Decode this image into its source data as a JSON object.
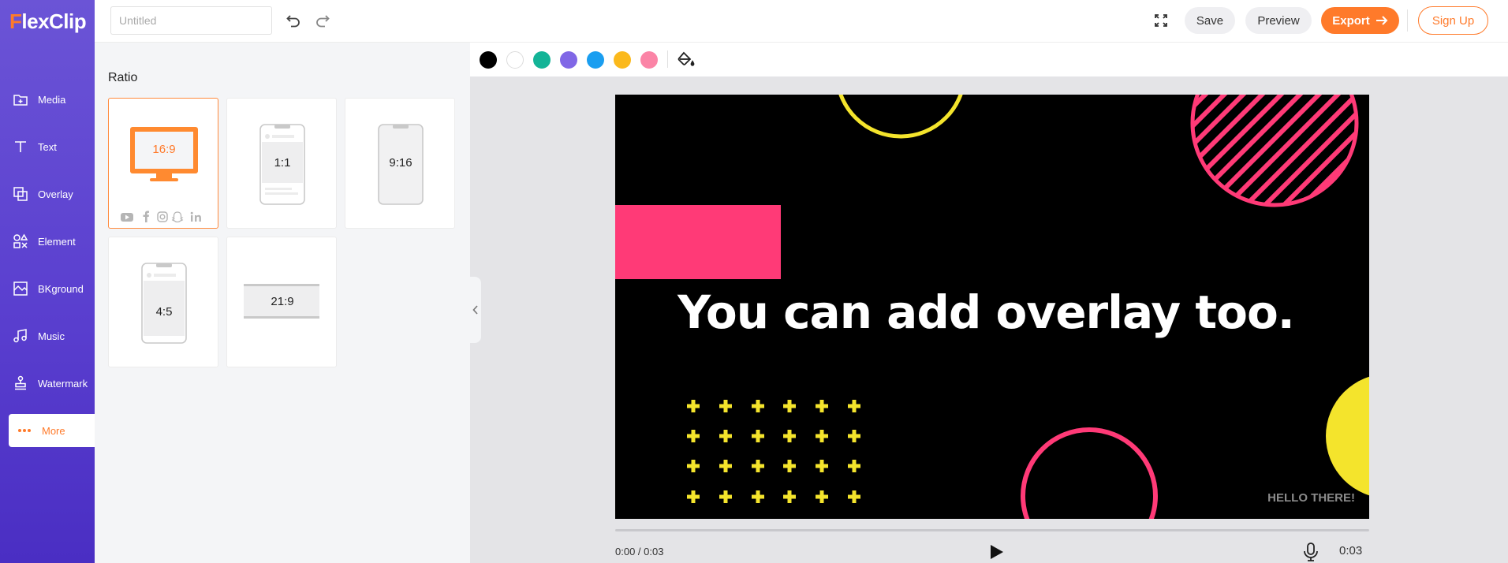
{
  "app": {
    "logo_first": "F",
    "logo_rest": "lexClip"
  },
  "nav": {
    "items": [
      {
        "label": "Media",
        "icon": "media-icon"
      },
      {
        "label": "Text",
        "icon": "text-icon"
      },
      {
        "label": "Overlay",
        "icon": "overlay-icon"
      },
      {
        "label": "Element",
        "icon": "element-icon"
      },
      {
        "label": "BKground",
        "icon": "background-icon"
      },
      {
        "label": "Music",
        "icon": "music-icon"
      },
      {
        "label": "Watermark",
        "icon": "watermark-icon"
      },
      {
        "label": "More",
        "icon": "more-icon",
        "active": true
      }
    ]
  },
  "toolbar": {
    "title_value": "",
    "title_placeholder": "Untitled",
    "save_label": "Save",
    "preview_label": "Preview",
    "export_label": "Export",
    "signup_label": "Sign Up"
  },
  "panel": {
    "heading": "Ratio",
    "ratios": [
      {
        "label": "16:9",
        "selected": true,
        "device": "monitor"
      },
      {
        "label": "1:1",
        "selected": false,
        "device": "phone"
      },
      {
        "label": "9:16",
        "selected": false,
        "device": "phone"
      },
      {
        "label": "4:5",
        "selected": false,
        "device": "phone"
      },
      {
        "label": "21:9",
        "selected": false,
        "device": "wide"
      }
    ],
    "social_icons": [
      "youtube-icon",
      "facebook-icon",
      "instagram-icon",
      "snapchat-icon",
      "linkedin-icon"
    ]
  },
  "colors": {
    "accent": "#ff7a2a",
    "swatches": [
      "#000000",
      "#ffffff",
      "#13b497",
      "#8067e6",
      "#1a9ef0",
      "#fbb91c",
      "#fb84a6"
    ]
  },
  "canvas": {
    "headline": "You can add overlay too.",
    "corner_text": "HELLO THERE!"
  },
  "player": {
    "current_time": "0:00 / 0:03",
    "total_time": "0:03",
    "progress": 0
  }
}
